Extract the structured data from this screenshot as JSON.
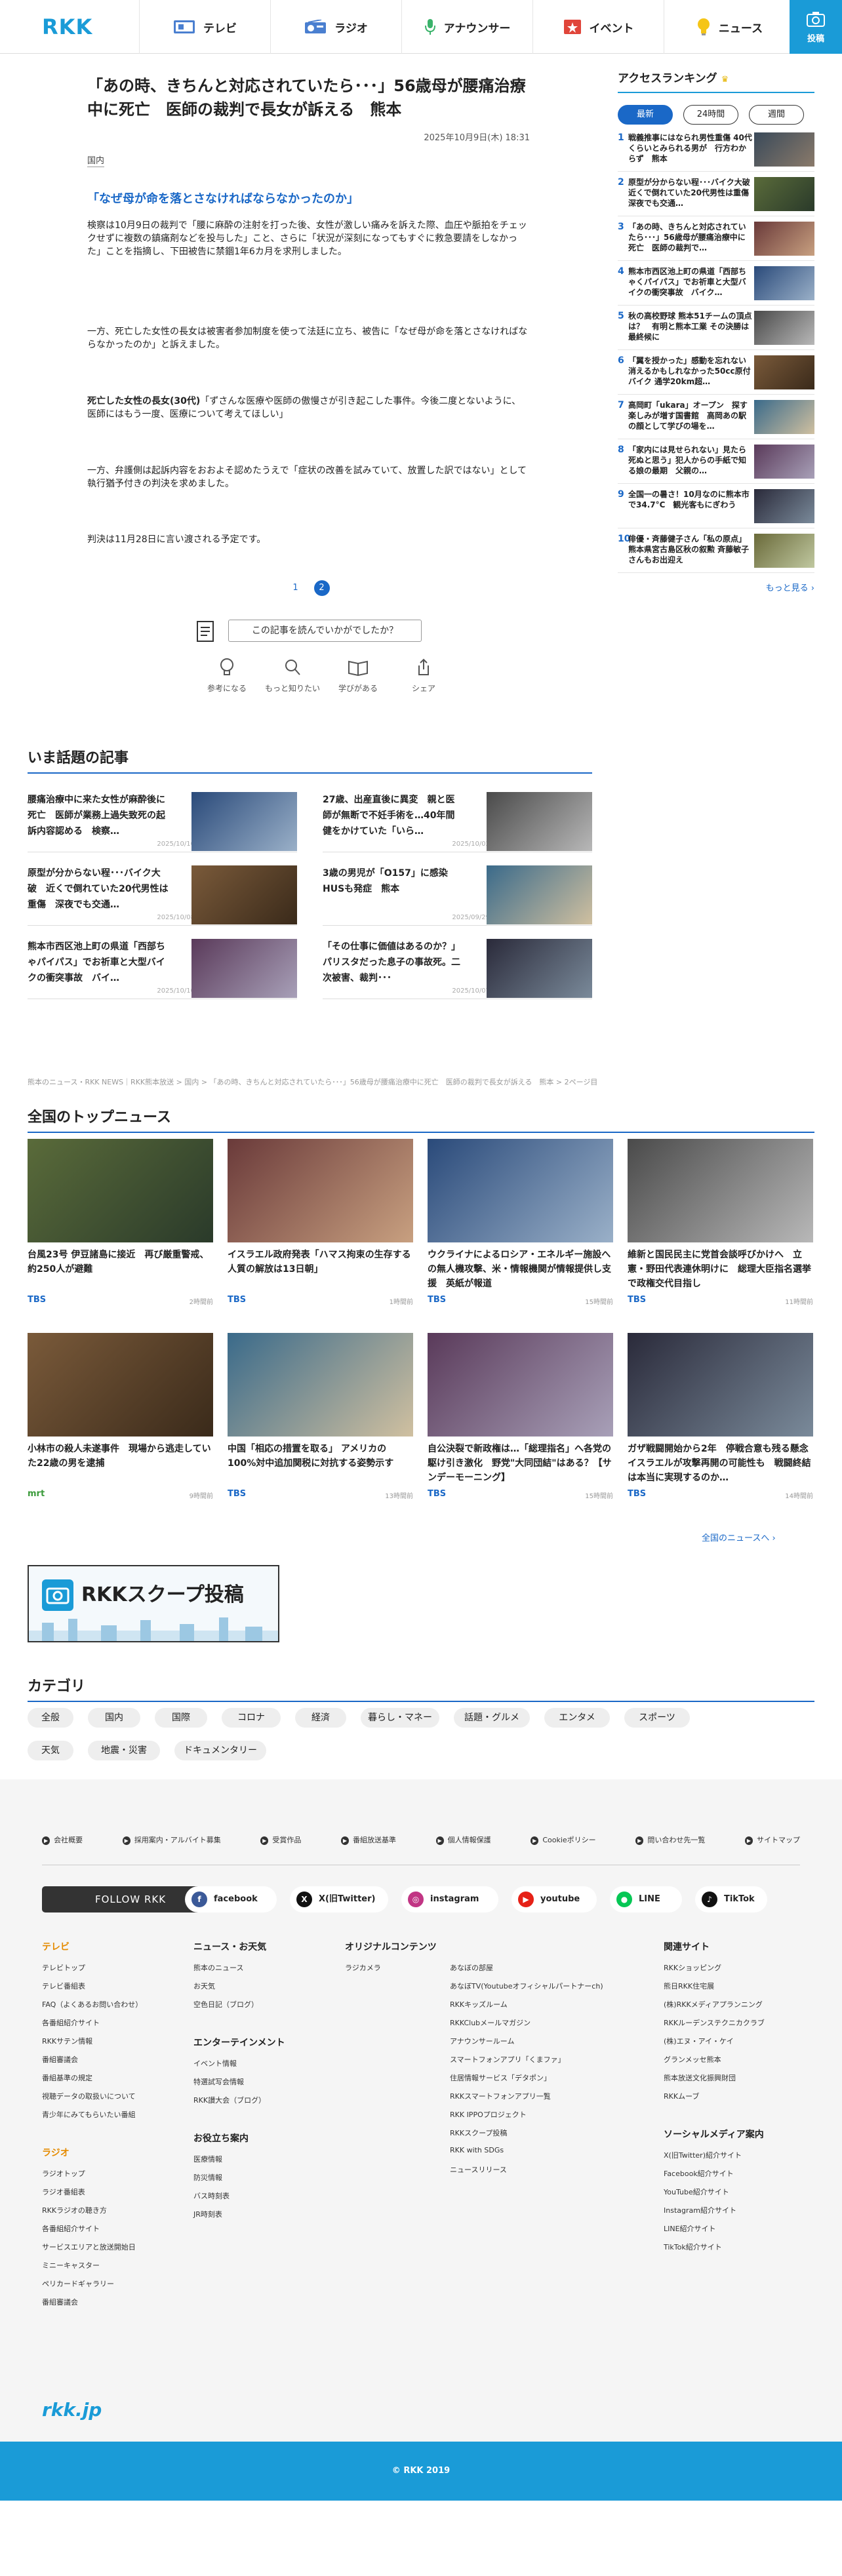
{
  "header": {
    "logo": "RKK",
    "nav": [
      {
        "label": "テレビ",
        "icon": "tv-icon"
      },
      {
        "label": "ラジオ",
        "icon": "radio-icon"
      },
      {
        "label": "アナウンサー",
        "icon": "microphone-icon"
      },
      {
        "label": "イベント",
        "icon": "event-icon"
      },
      {
        "label": "ニュース",
        "icon": "lightbulb-icon"
      }
    ],
    "post_label": "投稿",
    "colors": {
      "brand": "#1a9bd7",
      "accent": "#1a68c7"
    }
  },
  "article": {
    "title": "「あの時、きちんと対応されていたら･･･」56歳母が腰痛治療中に死亡　医師の裁判で長女が訴える　熊本",
    "date": "2025年10月9日(木) 18:31",
    "category": "国内",
    "lead": "「なぜ母が命を落とさなければならなかったのか」",
    "p1": "検察は10月9日の裁判で「腰に麻酔の注射を打った後、女性が激しい痛みを訴えた際、血圧や脈拍をチェックせずに複数の鎮痛剤などを投与した」こと、さらに「状況が深刻になってもすぐに救急要請をしなかった」ことを指摘し、下田被告に禁錮1年6カ月を求刑しました。",
    "p2": "一方、死亡した女性の長女は被害者参加制度を使って法廷に立ち、被告に「なぜ母が命を落とさなければならなかったのか」と訴えました。",
    "p3_bold": "死亡した女性の長女(30代)",
    "p3_rest": "「ずさんな医療や医師の傲慢さが引き起こした事件。今後二度とないように、医師にはもう一度、医療について考えてほしい」",
    "p4": "一方、弁護側は起訴内容をおおよそ認めたうえで「症状の改善を試みていて、放置した訳ではない」として執行猶予付きの判決を求めました。",
    "p5": "判決は11月28日に言い渡される予定です。",
    "pages": [
      "1",
      "2"
    ],
    "survey_prompt": "この記事を読んでいかがでしたか？",
    "reactions": [
      "参考になる",
      "もっと知りたい",
      "学びがある",
      "シェア"
    ]
  },
  "ranking": {
    "title": "アクセスランキング",
    "tabs": [
      "最新",
      "24時間",
      "週間"
    ],
    "items": [
      "戦義推事にはなられ男性重傷 40代くらいとみられる男が　行方わからず　熊本",
      "原型が分からない程･･･バイク大破　近くで倒れていた20代男性は重傷　深夜でも交通…",
      "「あの時、きちんと対応されていたら･･･」56歳母が腰痛治療中に死亡　医師の裁判で…",
      "熊本市西区池上町の県道「西部ちゃくパイパス」でお祈車と大型バイクの衝突事故　バイク…",
      "秋の高校野球 熊本51チームの頂点は？　有明と熊本工業 その決勝は最終候に",
      "「翼を授かった」感動を忘れない　消えるかもしれなかった50cc原付バイク 通学20km超…",
      "高岡町「ukara」オープン　探す楽しみが増す国書館　高岡あの駅の顔として学びの場を…",
      "「家内には見せられない」見たら死ぬと思う」犯人からの手紙で知る娘の最期　父親の…",
      "全国一の暑さ！10月なのに熊本市で34.7°C　観光客もにぎわう",
      "俳優・斉藤健子さん「私の原点」熊本県宮古島区秋の叙勲 斉藤敏子さんもお出迎え"
    ],
    "more": "もっと見る ›"
  },
  "hot": {
    "title": "いま話題の記事",
    "items": [
      {
        "title": "腰痛治療中に来た女性が麻酔後に死亡　医師が業務上過失致死の起訴内容認める　検察…",
        "date": "2025/10/10"
      },
      {
        "title": "27歳、出産直後に異変　親と医師が無断で不妊手術を…40年間健をかけていた「いら…",
        "date": "2025/10/02"
      },
      {
        "title": "原型が分からない程･･･バイク大破　近くで倒れていた20代男性は重傷　深夜でも交通…",
        "date": "2025/10/08"
      },
      {
        "title": "3歳の男児が「O157」に感染　HUSも発症　熊本",
        "date": "2025/09/29"
      },
      {
        "title": "熊本市西区池上町の県道「西部ちゃパイパス」でお祈車と大型バイクの衝突事故　バイ…",
        "date": "2025/10/10"
      },
      {
        "title": "「その仕事に価値はあるのか？」パリスタだった息子の事故死。二次被害、裁判･･･",
        "date": "2025/10/07"
      }
    ]
  },
  "breadcrumb": "熊本のニュース・RKK NEWS｜RKK熊本放送 > 国内 > 「あの時、きちんと対応されていたら･･･」56歳母が腰痛治療中に死亡　医師の裁判で長女が訴える　熊本 > 2ページ目",
  "national": {
    "title": "全国のトップニュース",
    "items": [
      {
        "title": "台風23号 伊豆諸島に接近　再び厳重警戒、約250人が避難",
        "source": "TBS",
        "ago": "2時間前"
      },
      {
        "title": "イスラエル政府発表「ハマス拘束の生存する人質の解放は13日朝」",
        "source": "TBS",
        "ago": "1時間前"
      },
      {
        "title": "ウクライナによるロシア・エネルギー施設への無人機攻撃、米・情報機関が情報提供し支援　英紙が報道",
        "source": "TBS",
        "ago": "15時間前"
      },
      {
        "title": "維新と国民民主に党首会談呼びかけへ　立憲・野田代表連休明けに　総理大臣指名選挙で政権交代目指し",
        "source": "TBS",
        "ago": "11時間前"
      },
      {
        "title": "小林市の殺人未遂事件　現場から逃走していた22歳の男を逮捕",
        "source": "mrt",
        "ago": "9時間前"
      },
      {
        "title": "中国「相応の措置を取る」 アメリカの100%対中追加関税に対抗する姿勢示す",
        "source": "TBS",
        "ago": "13時間前"
      },
      {
        "title": "自公決裂で新政権は…「総理指名」へ各党の駆け引き激化　野党\"大同団結\"はある？【サンデーモーニング】",
        "source": "TBS",
        "ago": "15時間前"
      },
      {
        "title": "ガザ戦闘開始から2年　停戦合意も残る懸念　イスラエルが攻撃再開の可能性も　戦闘終結は本当に実現するのか…",
        "source": "TBS",
        "ago": "14時間前"
      }
    ],
    "more": "全国のニュースへ ›"
  },
  "banner": {
    "label": "RKKスクープ投稿"
  },
  "categories": {
    "title": "カテゴリ",
    "chips": [
      "全般",
      "国内",
      "国際",
      "コロナ",
      "経済",
      "暮らし・マネー",
      "話題・グルメ",
      "エンタメ",
      "スポーツ",
      "天気",
      "地震・災害",
      "ドキュメンタリー"
    ]
  },
  "footer": {
    "links": [
      "会社概要",
      "採用案内・アルバイト募集",
      "受賞作品",
      "番組放送基準",
      "個人情報保護",
      "Cookieポリシー",
      "問い合わせ先一覧",
      "サイトマップ"
    ],
    "follow": "FOLLOW RKK",
    "sns": [
      "facebook",
      "X(旧Twitter)",
      "instagram",
      "youtube",
      "LINE",
      "TikTok"
    ],
    "col_tv": {
      "title": "テレビ",
      "items": [
        "テレビトップ",
        "テレビ番組表",
        "FAQ（よくあるお問い合わせ）",
        "各番組紹介サイト",
        "RKKサテン情報",
        "番組審議会",
        "番組基準の規定",
        "視聴データの取扱いについて",
        "青少年にみてもらいたい番組"
      ]
    },
    "col_radio": {
      "title": "ラジオ",
      "items": [
        "ラジオトップ",
        "ラジオ番組表",
        "RKKラジオの聴き方",
        "各番組紹介サイト",
        "サービスエリアと放送開始日",
        "ミニーキャスター",
        "ペリカードギャラリー",
        "番組審議会"
      ]
    },
    "col_news": {
      "title": "ニュース・お天気",
      "items": [
        "熊本のニュース",
        "お天気",
        "空色日記（ブログ）"
      ]
    },
    "col_ent": {
      "title": "エンターテインメント",
      "items": [
        "イベント情報",
        "特選試写会情報",
        "RKK讃大会（ブログ）"
      ]
    },
    "col_useful": {
      "title": "お役立ち案内",
      "items": [
        "医療情報",
        "防災情報",
        "バス時刻表",
        "JR時刻表"
      ]
    },
    "col_orig": {
      "title": "オリジナルコンテンツ",
      "items": [
        "ラジカメラ"
      ]
    },
    "col_orig2": {
      "items": [
        "あなぼの部屋",
        "あなぼTV(Youtubeオフィシャルパートナーch)",
        "RKKキッズルーム",
        "RKKClubメールマガジン",
        "アナウンサールーム",
        "スマートフォンアプリ「くまファ」",
        "住居情報サービス「デタポン」",
        "RKKスマートフォンアプリ一覧",
        "RKK IPPOプロジェクト",
        "RKKスクープ投稿",
        "RKK with SDGs",
        "ニュースリリース"
      ]
    },
    "col_rel": {
      "title": "関連サイト",
      "items": [
        "RKKショッピング",
        "熊日RKK住宅展",
        "(株)RKKメディアプランニング",
        "RKKルーデンステクニカクラブ",
        "(株)エヌ・アイ・ケイ",
        "グランメッセ熊本",
        "熊本放送文化振興財団",
        "RKKムーブ"
      ]
    },
    "col_social": {
      "title": "ソーシャルメディア案内",
      "items": [
        "X(旧Twitter)紹介サイト",
        "Facebook紹介サイト",
        "YouTube紹介サイト",
        "Instagram紹介サイト",
        "LINE紹介サイト",
        "TikTok紹介サイト"
      ]
    },
    "site_logo": "rkk.jp",
    "copyright": "© RKK 2019"
  }
}
